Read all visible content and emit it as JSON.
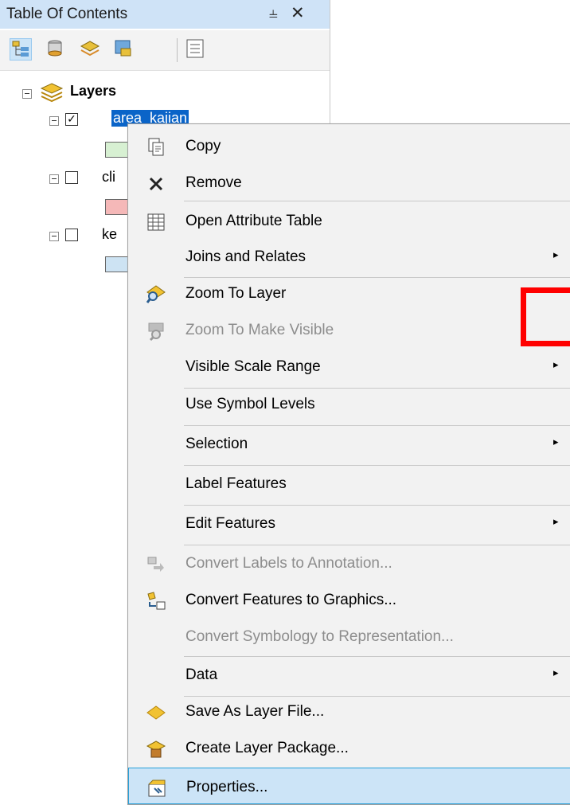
{
  "toc": {
    "title": "Table Of Contents",
    "pin_glyph": "⫨",
    "close_glyph": "✕",
    "toolbar": [
      {
        "icon": "list-by-drawing-order-icon"
      },
      {
        "icon": "list-by-source-icon"
      },
      {
        "icon": "list-by-visibility-icon"
      },
      {
        "icon": "list-by-selection-icon"
      },
      {
        "icon": "options-icon"
      }
    ],
    "root": {
      "label": "Layers",
      "icon": "layers-icon"
    },
    "layers": [
      {
        "name": "area_kajian",
        "checked": true,
        "color": "#d7f0d2"
      },
      {
        "name": "cli",
        "checked": false,
        "color": "#f5b8b8"
      },
      {
        "name": "ke",
        "checked": false,
        "color": "#cde3f3"
      }
    ]
  },
  "menu": {
    "items": [
      {
        "label": "Copy",
        "icon": "copy-icon",
        "disabled": false,
        "submenu": false
      },
      {
        "label": "Remove",
        "icon": "remove-icon",
        "disabled": false,
        "submenu": false
      },
      {
        "label": "Open Attribute Table",
        "icon": "table-icon",
        "disabled": false,
        "submenu": false
      },
      {
        "label": "Joins and Relates",
        "icon": "",
        "disabled": false,
        "submenu": true
      },
      {
        "label": "Zoom To Layer",
        "icon": "zoom-to-layer-icon",
        "disabled": false,
        "submenu": false
      },
      {
        "label": "Zoom To Make Visible",
        "icon": "zoom-to-make-visible-icon",
        "disabled": true,
        "submenu": false
      },
      {
        "label": "Visible Scale Range",
        "icon": "",
        "disabled": false,
        "submenu": true
      },
      {
        "label": "Use Symbol Levels",
        "icon": "",
        "disabled": false,
        "submenu": false
      },
      {
        "label": "Selection",
        "icon": "",
        "disabled": false,
        "submenu": true
      },
      {
        "label": "Label Features",
        "icon": "",
        "disabled": false,
        "submenu": false
      },
      {
        "label": "Edit Features",
        "icon": "",
        "disabled": false,
        "submenu": true
      },
      {
        "label": "Convert Labels to Annotation...",
        "icon": "convert-labels-icon",
        "disabled": true,
        "submenu": false
      },
      {
        "label": "Convert Features to Graphics...",
        "icon": "convert-features-icon",
        "disabled": false,
        "submenu": false
      },
      {
        "label": "Convert Symbology to Representation...",
        "icon": "",
        "disabled": true,
        "submenu": false
      },
      {
        "label": "Data",
        "icon": "",
        "disabled": false,
        "submenu": true
      },
      {
        "label": "Save As Layer File...",
        "icon": "save-layer-file-icon",
        "disabled": false,
        "submenu": false
      },
      {
        "label": "Create Layer Package...",
        "icon": "layer-package-icon",
        "disabled": false,
        "submenu": false
      },
      {
        "label": "Properties...",
        "icon": "properties-icon",
        "disabled": false,
        "submenu": false,
        "highlighted": true
      }
    ],
    "submenu_arrow": "▸"
  },
  "colors": {
    "titlebar": "#cfe3f7",
    "selection": "#0a64c8",
    "menu_bg": "#f2f2f2",
    "menu_highlight": "#cce4f7",
    "annotation_box": "#ff0000"
  }
}
